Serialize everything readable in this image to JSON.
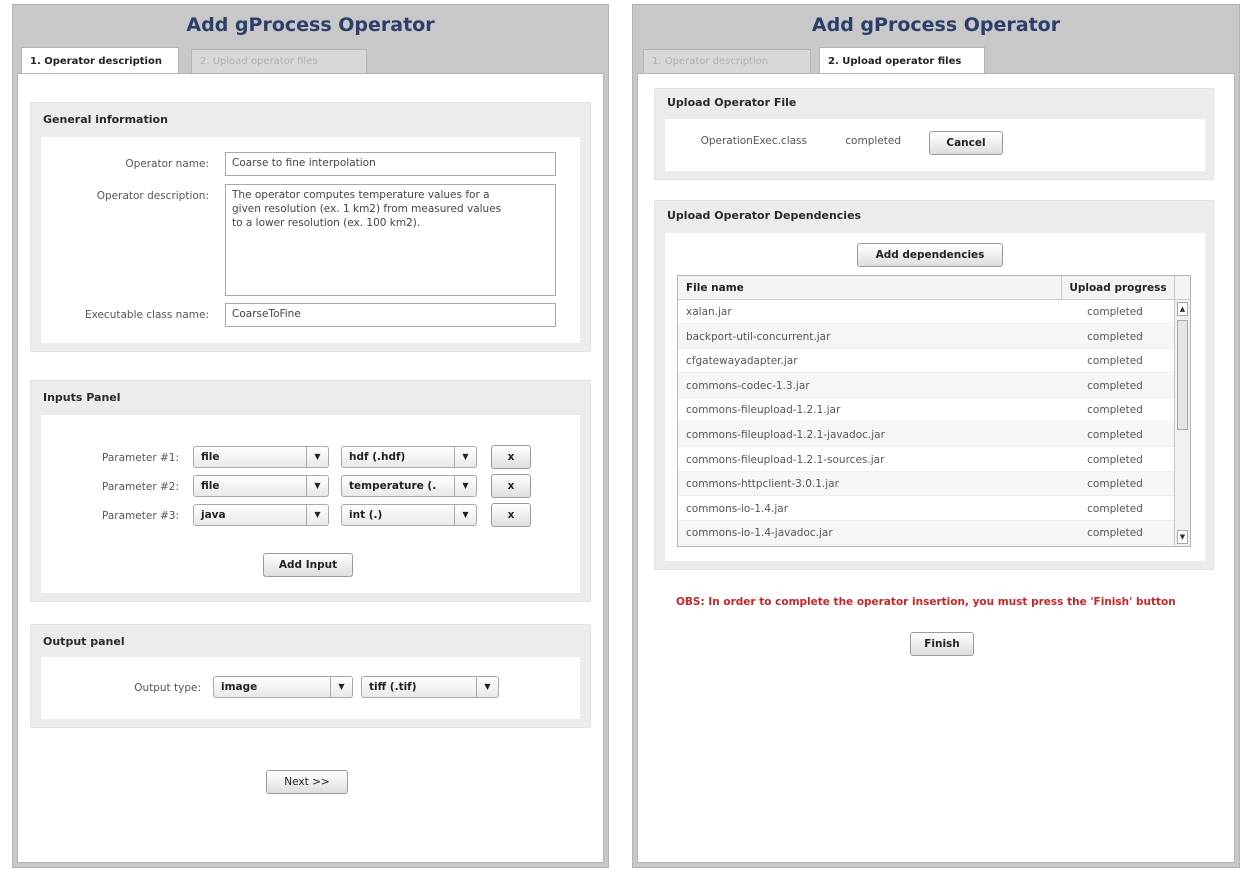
{
  "left": {
    "title": "Add gProcess Operator",
    "tabs": [
      "1. Operator description",
      "2. Upload operator files"
    ],
    "general": {
      "title": "General information",
      "name_label": "Operator name:",
      "name_value": "Coarse to fine interpolation",
      "desc_label": "Operator description:",
      "desc_value": "The operator computes temperature values for a\ngiven resolution (ex. 1 km2) from measured values\nto a lower resolution (ex. 100 km2).",
      "class_label": "Executable class name:",
      "class_value": "CoarseToFine"
    },
    "inputs": {
      "title": "Inputs Panel",
      "params": [
        {
          "label": "Parameter #1:",
          "type": "file",
          "format": "hdf (.hdf)",
          "remove": "x"
        },
        {
          "label": "Parameter #2:",
          "type": "file",
          "format": "temperature (.",
          "remove": "x"
        },
        {
          "label": "Parameter #3:",
          "type": "java",
          "format": "int (.)",
          "remove": "x"
        }
      ],
      "add_label": "Add Input"
    },
    "output": {
      "title": "Output panel",
      "label": "Output type:",
      "type": "image",
      "format": "tiff (.tif)"
    },
    "next_label": "Next >>"
  },
  "right": {
    "title": "Add gProcess Operator",
    "tabs": [
      "1. Operator description",
      "2. Upload operator files"
    ],
    "upload_file": {
      "title": "Upload Operator File",
      "file": "OperationExec.class",
      "status": "completed",
      "cancel_label": "Cancel"
    },
    "deps": {
      "title": "Upload Operator Dependencies",
      "add_label": "Add dependencies",
      "columns": [
        "File name",
        "Upload progress"
      ],
      "rows": [
        {
          "name": "xalan.jar",
          "progress": "completed"
        },
        {
          "name": "backport-util-concurrent.jar",
          "progress": "completed"
        },
        {
          "name": "cfgatewayadapter.jar",
          "progress": "completed"
        },
        {
          "name": "commons-codec-1.3.jar",
          "progress": "completed"
        },
        {
          "name": "commons-fileupload-1.2.1.jar",
          "progress": "completed"
        },
        {
          "name": "commons-fileupload-1.2.1-javadoc.jar",
          "progress": "completed"
        },
        {
          "name": "commons-fileupload-1.2.1-sources.jar",
          "progress": "completed"
        },
        {
          "name": "commons-httpclient-3.0.1.jar",
          "progress": "completed"
        },
        {
          "name": "commons-io-1.4.jar",
          "progress": "completed"
        },
        {
          "name": "commons-io-1.4-javadoc.jar",
          "progress": "completed"
        }
      ]
    },
    "note": "OBS: In order to complete the operator insertion, you must press the 'Finish' button",
    "finish_label": "Finish"
  }
}
